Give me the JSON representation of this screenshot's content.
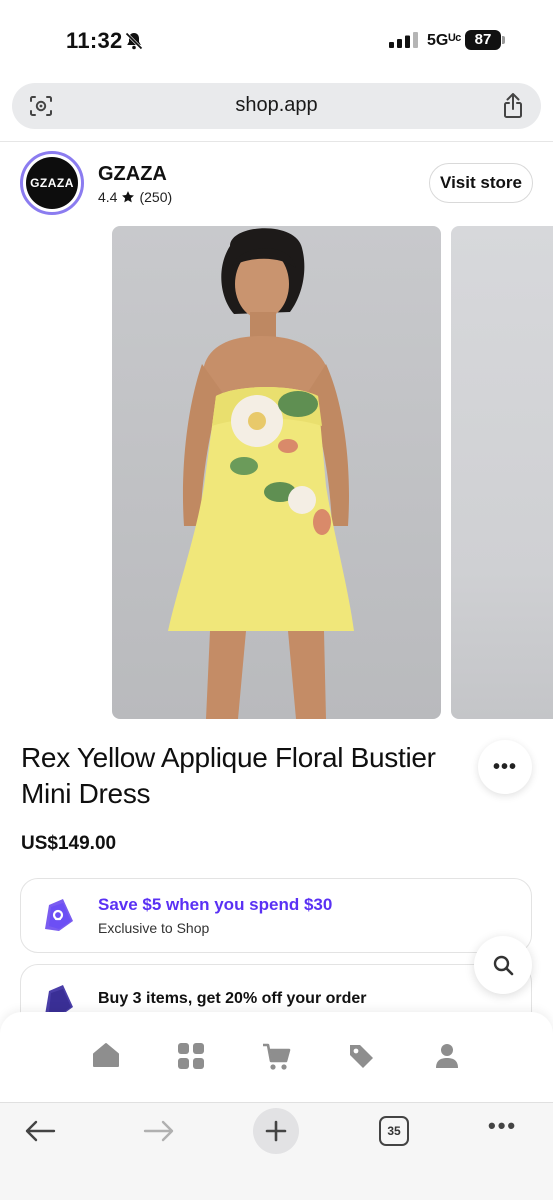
{
  "status_bar": {
    "time": "11:32",
    "network": "5Gᵁᶜ",
    "battery": "87"
  },
  "browser": {
    "url": "shop.app",
    "tab_count": "35"
  },
  "store": {
    "logo_text": "GZAZA",
    "name": "GZAZA",
    "rating": "4.4",
    "review_count": "(250)",
    "visit_button": "Visit store"
  },
  "product": {
    "title": "Rex Yellow Applique Floral Bustier Mini Dress",
    "price": "US$149.00"
  },
  "offers": [
    {
      "title": "Save $5 when you spend $30",
      "subtitle": "Exclusive to Shop"
    },
    {
      "title": "Buy 3 items, get 20% off your order"
    }
  ],
  "bottom_nav": [
    "home-icon",
    "categories-icon",
    "cart-icon",
    "tag-icon",
    "account-icon"
  ],
  "colors": {
    "accent": "#5a31f4",
    "offer_tag": "#6c4ff5",
    "dress_yellow": "#f0e77a"
  }
}
